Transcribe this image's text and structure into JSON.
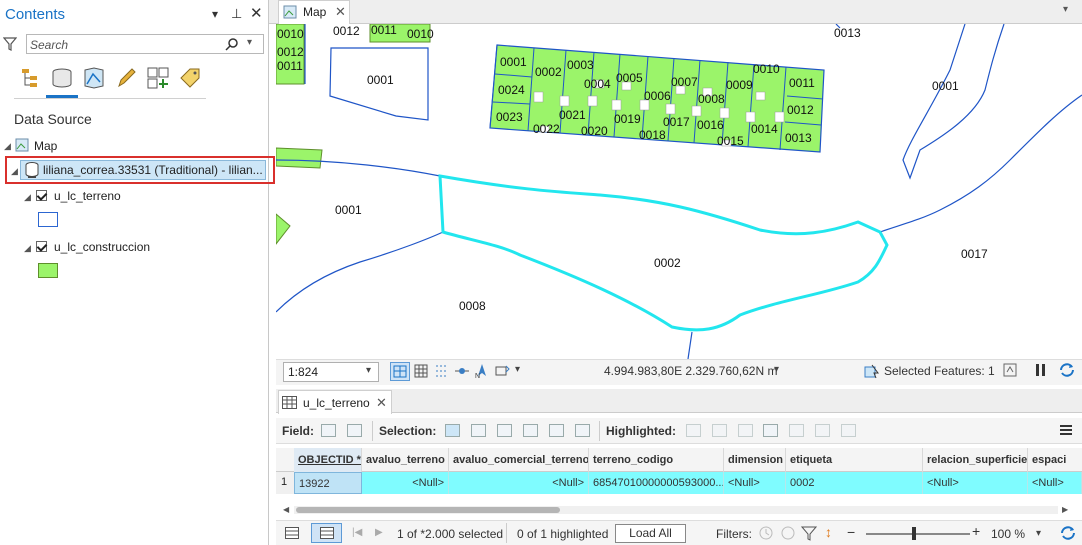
{
  "contents": {
    "title": "Contents",
    "search_placeholder": "Search",
    "data_source_heading": "Data Source",
    "map_node": "Map",
    "layer_source": "liliana_correa.33531 (Traditional) - lilian...",
    "layers": [
      {
        "name": "u_lc_terreno",
        "symbol_color": "#2c66d1"
      },
      {
        "name": "u_lc_construccion",
        "symbol_color": "#9bf46a"
      }
    ]
  },
  "map": {
    "tab_label": "Map",
    "labels": {
      "p0010_left": "0010",
      "p0012_left": "0012",
      "p0011_left": "0011",
      "p0012_top": "0012",
      "p0011_top": "0011",
      "p0010_top": "0010",
      "p0001_a": "0001",
      "p0013_top": "0013",
      "p0001_right": "0001",
      "p0001_mid": "0001",
      "p0002": "0002",
      "p0017": "0017",
      "p0008": "0008"
    },
    "building_labels": [
      "0001",
      "0002",
      "0003",
      "0004",
      "0005",
      "0006",
      "0007",
      "0008",
      "0009",
      "0010",
      "0011",
      "0012",
      "0013",
      "0014",
      "0015",
      "0016",
      "0017",
      "0018",
      "0019",
      "0020",
      "0021",
      "0022",
      "0023",
      "0024"
    ],
    "scale": "1:824",
    "coordinates": "4.994.983,80E 2.329.760,62N m",
    "selected_features": "Selected Features: 1",
    "colors": {
      "building_fill": "#9bf46a",
      "parcel_line": "#1f55c7",
      "selection": "#22e6ee"
    }
  },
  "table": {
    "tab_label": "u_lc_terreno",
    "toolbar": {
      "field_label": "Field:",
      "selection_label": "Selection:",
      "highlighted_label": "Highlighted:"
    },
    "columns": [
      "OBJECTID *",
      "avaluo_terreno",
      "avaluo_comercial_terreno",
      "terreno_codigo",
      "dimension",
      "etiqueta",
      "relacion_superficie",
      "espaci"
    ],
    "rows": [
      {
        "row_num": "1",
        "cells": [
          "13922",
          "<Null>",
          "<Null>",
          "68547010000000593000...",
          "<Null>",
          "0002",
          "<Null>",
          "<Null>"
        ]
      }
    ],
    "status": {
      "selected": "1 of *2.000 selected",
      "highlighted": "0 of 1 highlighted",
      "load_all": "Load All",
      "filters": "Filters:",
      "zoom": "100 %"
    }
  }
}
